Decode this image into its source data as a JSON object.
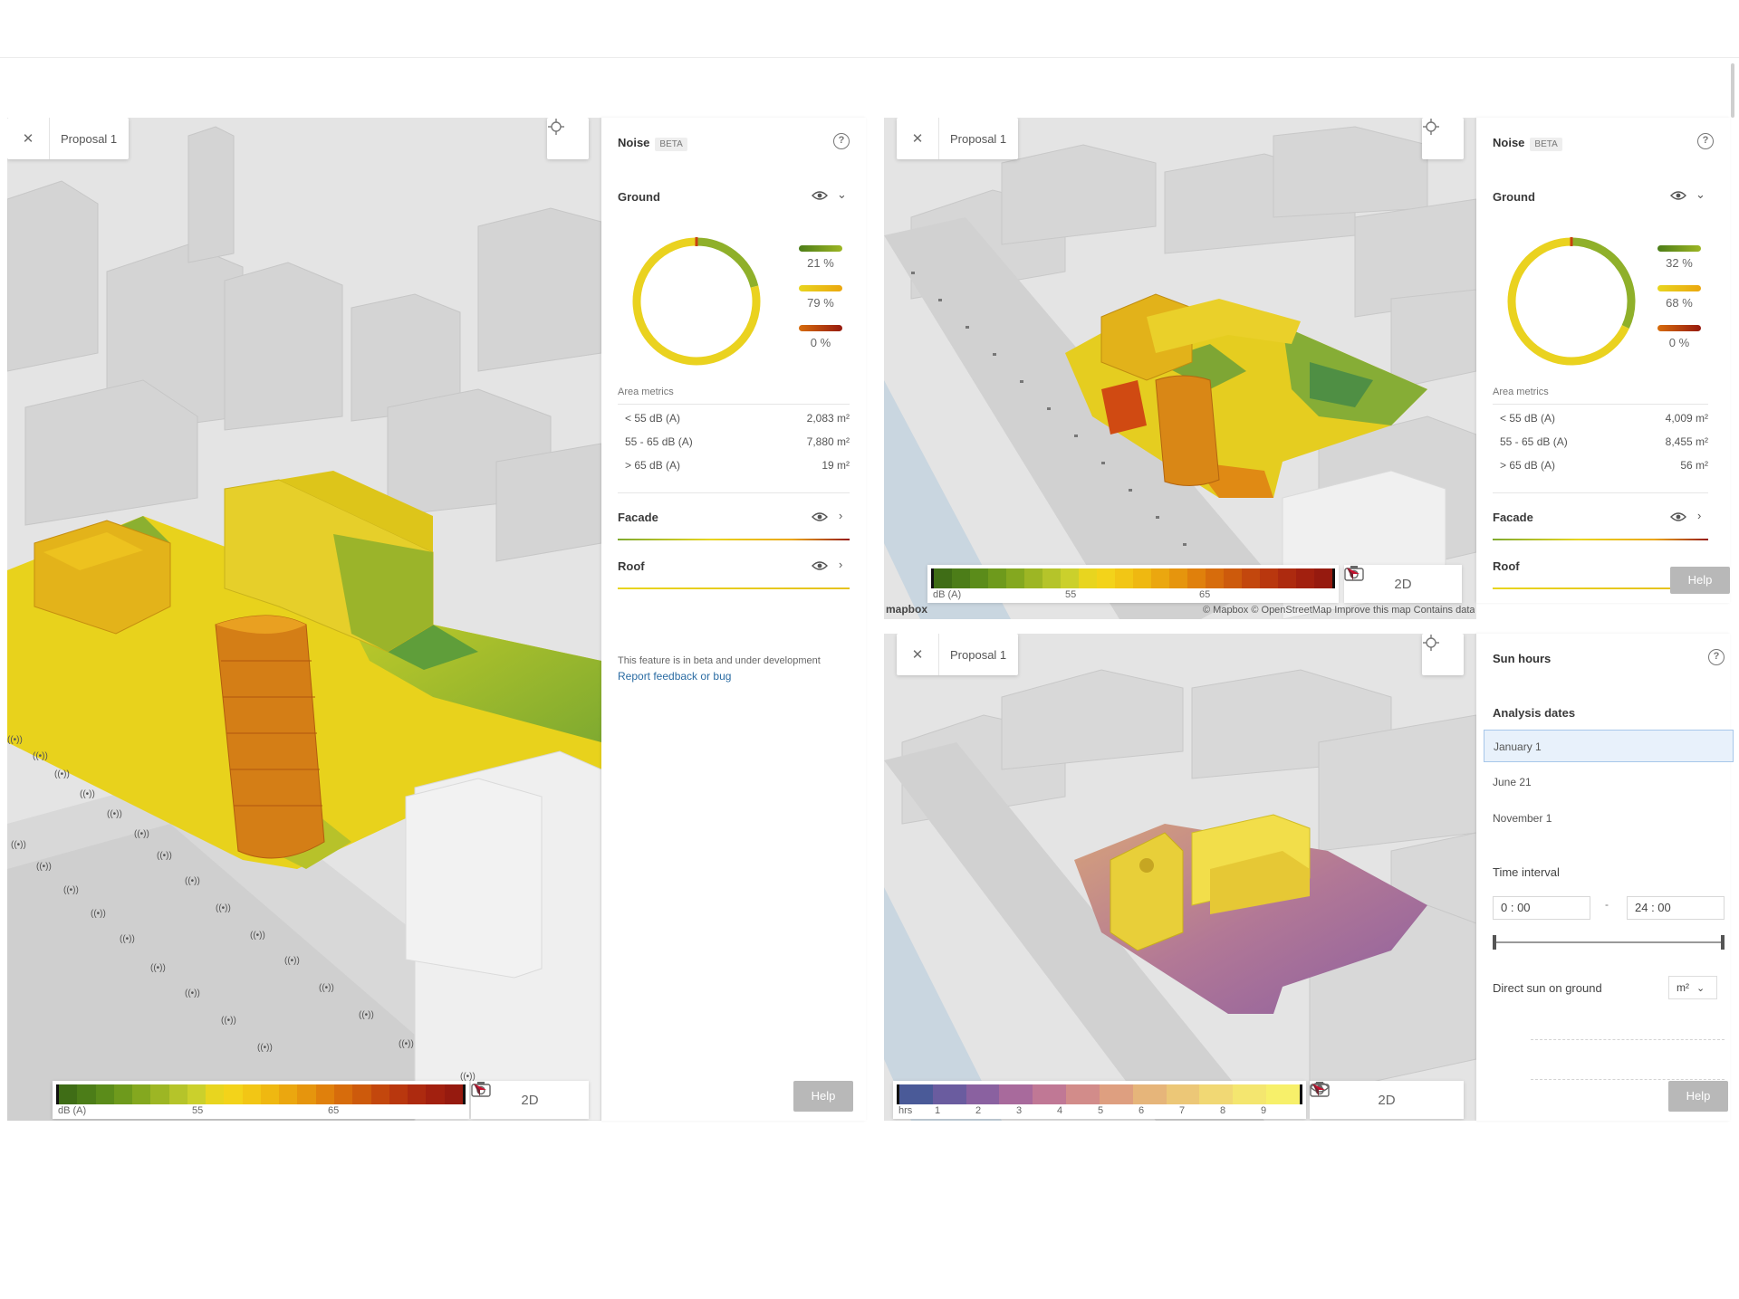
{
  "left_view": {
    "proposal_label": "Proposal 1",
    "close_icon": "close-icon",
    "locate_icon": "crosshair-icon",
    "legend": {
      "unit": "dB (A)",
      "ticks": [
        "55",
        "65"
      ],
      "colors": [
        "#3f6d16",
        "#4c7d18",
        "#5b8c1a",
        "#6e9a1c",
        "#84a81f",
        "#9db624",
        "#b5c42a",
        "#cbd02c",
        "#e8d51f",
        "#f3d31a",
        "#f2c615",
        "#efb811",
        "#eba70f",
        "#e6950d",
        "#e0800c",
        "#d76c0c",
        "#cd5a0c",
        "#c3470d",
        "#b9370e",
        "#ad2a0f",
        "#a2200f",
        "#961a0f"
      ]
    },
    "tools": {
      "mode_label": "2D",
      "camera_icon": "camera-icon",
      "compass_icon": "compass-icon"
    }
  },
  "left_panel": {
    "title": "Noise",
    "badge": "BETA",
    "ground": {
      "label": "Ground",
      "ring_values": [
        0.21,
        0.79,
        0.0
      ],
      "pcts": [
        "21 %",
        "79 %",
        "0 %"
      ]
    },
    "area_metrics": {
      "label": "Area metrics",
      "rows": [
        {
          "label": "< 55 dB (A)",
          "value": "2,083 m²"
        },
        {
          "label": "55 - 65 dB (A)",
          "value": "7,880 m²"
        },
        {
          "label": "> 65 dB (A)",
          "value": "19 m²"
        }
      ]
    },
    "facade_label": "Facade",
    "roof_label": "Roof",
    "beta_note": "This feature is in beta and under development",
    "feedback_link": "Report feedback or bug",
    "help_label": "Help"
  },
  "top_right_view": {
    "proposal_label": "Proposal 1",
    "legend": {
      "unit": "dB (A)",
      "ticks": [
        "55",
        "65"
      ]
    },
    "tools": {
      "mode_label": "2D"
    },
    "attribution": "© Mapbox © OpenStreetMap  Improve this map  Contains data from IGN France  OpenStreetMap  IGN France  IGN",
    "mapbox_logo": "mapbox"
  },
  "top_right_panel": {
    "title": "Noise",
    "badge": "BETA",
    "ground": {
      "label": "Ground",
      "ring_values": [
        0.32,
        0.68,
        0.0
      ],
      "pcts": [
        "32 %",
        "68 %",
        "0 %"
      ]
    },
    "area_metrics": {
      "label": "Area metrics",
      "rows": [
        {
          "label": "< 55 dB (A)",
          "value": "4,009 m²"
        },
        {
          "label": "55 - 65 dB (A)",
          "value": "8,455 m²"
        },
        {
          "label": "> 65 dB (A)",
          "value": "56 m²"
        }
      ]
    },
    "facade_label": "Facade",
    "roof_label": "Roof",
    "help_label": "Help"
  },
  "bottom_right_view": {
    "proposal_label": "Proposal 1",
    "legend": {
      "unit": "hrs",
      "ticks": [
        "1",
        "2",
        "3",
        "4",
        "5",
        "6",
        "7",
        "8",
        "9"
      ],
      "colors": [
        "#4a5a98",
        "#6a5c9f",
        "#8a61a0",
        "#a86a9c",
        "#c07895",
        "#d28c8a",
        "#de9f80",
        "#e6b57a",
        "#ecc777",
        "#f1d874",
        "#f4e66f",
        "#f7f06a"
      ]
    },
    "tools": {
      "mode_label": "2D"
    }
  },
  "sun_panel": {
    "title": "Sun hours",
    "analysis_dates_label": "Analysis dates",
    "dates": [
      "January 1",
      "June 21",
      "November 1"
    ],
    "selected_date": 0,
    "time_interval_label": "Time interval",
    "time_from": "0  : 00",
    "time_sep": "-",
    "time_to": "24  : 00",
    "direct_sun_label": "Direct sun on ground",
    "unit": "m²",
    "help_label": "Help"
  }
}
